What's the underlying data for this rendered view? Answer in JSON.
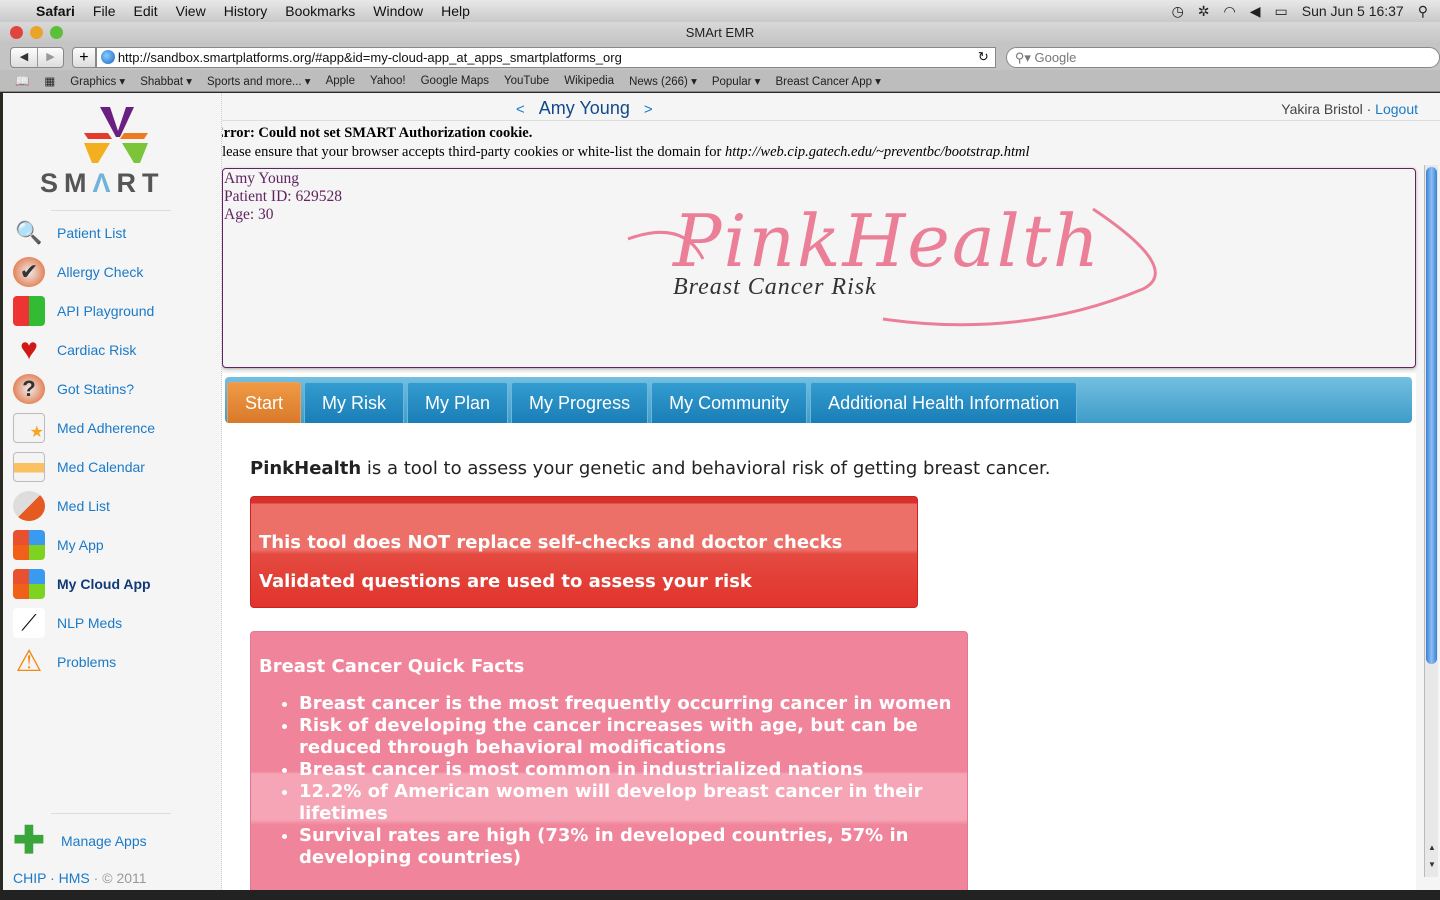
{
  "menubar": {
    "app": "Safari",
    "items": [
      "File",
      "Edit",
      "View",
      "History",
      "Bookmarks",
      "Window",
      "Help"
    ],
    "clock": "Sun Jun 5  16:37"
  },
  "window": {
    "title": "SMArt EMR"
  },
  "toolbar": {
    "url": "http://sandbox.smartplatforms.org/#app&id=my-cloud-app_at_apps_smartplatforms_org",
    "search_placeholder": "Google"
  },
  "bookmarks": [
    "Graphics ▾",
    "Shabbat ▾",
    "Sports and more... ▾",
    "Apple",
    "Yahoo!",
    "Google Maps",
    "YouTube",
    "Wikipedia",
    "News (266) ▾",
    "Popular ▾",
    "Breast Cancer App ▾"
  ],
  "sidebar": {
    "logo": "SMART",
    "items": [
      {
        "label": "Patient List",
        "icon": "magnifier-icon"
      },
      {
        "label": "Allergy Check",
        "icon": "checkmark-icon"
      },
      {
        "label": "API Playground",
        "icon": "blocks-icon"
      },
      {
        "label": "Cardiac Risk",
        "icon": "heart-icon"
      },
      {
        "label": "Got Statins?",
        "icon": "question-icon"
      },
      {
        "label": "Med Adherence",
        "icon": "calendar-star-icon"
      },
      {
        "label": "Med Calendar",
        "icon": "calendar-icon"
      },
      {
        "label": "Med List",
        "icon": "pill-icon"
      },
      {
        "label": "My App",
        "icon": "app-tiles-icon"
      },
      {
        "label": "My Cloud App",
        "icon": "app-tiles-icon",
        "active": true
      },
      {
        "label": "NLP Meds",
        "icon": "tweezers-icon"
      },
      {
        "label": "Problems",
        "icon": "warning-icon"
      }
    ],
    "manage": "Manage Apps",
    "footer": {
      "chip": "CHIP",
      "hms": "HMS",
      "copy": "© 2011"
    }
  },
  "header": {
    "patient": "Amy Young",
    "prev": "<",
    "next": ">",
    "user": "Yakira Bristol",
    "logout": "Logout"
  },
  "error": {
    "title": "Error: Could not set SMART Authorization cookie.",
    "message": "Please ensure that your browser accepts third-party cookies or white-list the domain for ",
    "domain": "http://web.cip.gatech.edu/~preventbc/bootstrap.html"
  },
  "patient": {
    "name": "Amy Young",
    "id": "Patient ID: 629528",
    "age": "Age: 30"
  },
  "brand": {
    "name": "PinkHealth",
    "tagline": "Breast Cancer Risk"
  },
  "tabs": [
    "Start",
    "My Risk",
    "My Plan",
    "My Progress",
    "My Community",
    "Additional Health Information"
  ],
  "content": {
    "intro_bold": "PinkHealth",
    "intro": " is a tool to assess your genetic and behavioral risk of getting breast cancer.",
    "notices": [
      "This tool does NOT replace self-checks and doctor checks",
      "Validated questions are used to assess your risk"
    ],
    "facts_title": "Breast Cancer Quick Facts",
    "facts": [
      "Breast cancer is the most frequently occurring cancer in women",
      "Risk of developing the cancer increases with age, but can be reduced through behavioral modifications",
      "Breast cancer is most common in industrialized nations",
      "12.2% of American women will develop breast cancer in their lifetimes",
      "Survival rates are high (73% in developed countries, 57% in developing countries)"
    ]
  },
  "colors": {
    "tab_active": "#e0812f",
    "tab": "#2189c2",
    "notice_red": "#e1342c",
    "facts_pink": "#f0849b",
    "link": "#1a7ac8"
  }
}
